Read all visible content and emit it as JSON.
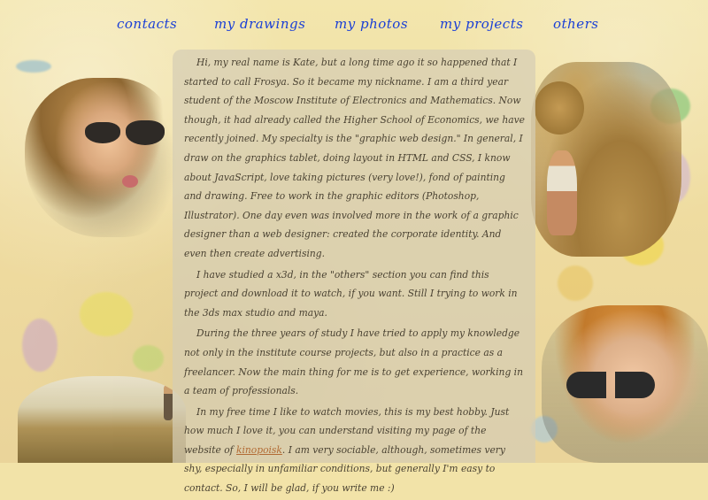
{
  "nav": {
    "contacts": "contacts",
    "drawings": "my drawings",
    "photos": "my photos",
    "projects": "my projects",
    "others": "others"
  },
  "article": {
    "p1": "Hi, my real name is Kate, but a long time ago it so happened that I started to call Frosya. So it became my nickname. I am a third year student of the Moscow Institute of Electronics and Mathematics. Now though, it had already called the Higher School of Economics, we have recently joined. My specialty is the \"graphic web design.\" In general, I draw on the graphics tablet, doing layout in HTML and CSS, I know about JavaScript, love taking pictures (very love!), fond of painting and drawing. Free to work in the graphic editors (Photoshop, Illustrator). One day even was involved more in the work of a graphic designer than a web designer: created the corporate identity. And even then create advertising.",
    "p2": "I have studied a x3d, in the \"others\" section you can find this project and download it to watch, if you want. Still I trying to work in the 3ds max studio and maya.",
    "p3": "During the three years of study I have tried to apply my knowledge not only in the institute course projects, but also in a practice as a freelancer. Now the main thing for me is to get experience, working in a team of professionals.",
    "p4_before": "In my free time I like to watch movies, this is my best hobby. Just how much I love it, you can understand visiting my page of the website of ",
    "p4_link": "kinopoisk",
    "p4_after": ". I am very sociable, although, sometimes very shy, especially in unfamiliar conditions, but generally I'm easy to contact. So, I will be glad, if you write me :)"
  },
  "colors": {
    "nav_link": "#1a3fd6",
    "text": "#4a4232",
    "link_inline": "#b26b35",
    "background": "#f2e3a8"
  }
}
